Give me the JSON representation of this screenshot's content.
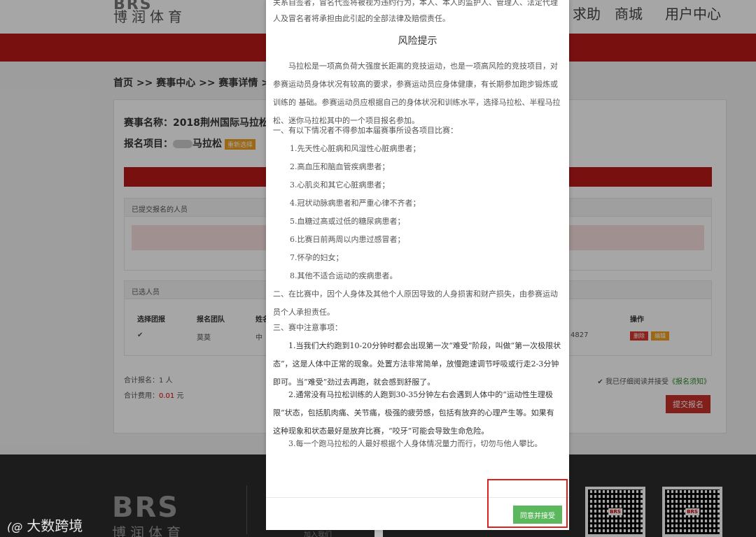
{
  "header": {
    "logo_brs": "BRS",
    "logo_cn": "博润体育",
    "nav": [
      "求助",
      "商城",
      "用户中心"
    ]
  },
  "breadcrumb": "首页 >> 赛事中心 >> 赛事详情 >> 赛",
  "event": {
    "name_label": "赛事名称：2018荆州国际马拉松",
    "project_label": "报名项目：",
    "project_name": "马拉松",
    "reselect": "重新选择"
  },
  "submitted_panel": {
    "title": "已提交报名的人员"
  },
  "selected_panel": {
    "title": "已选人员",
    "columns": [
      "选择团报",
      "报名团队",
      "姓名",
      "操作"
    ],
    "row": {
      "checkbox": "✔",
      "team": "莫莫",
      "name": "中",
      "phone_tail": "4827",
      "delete": "删除",
      "edit": "编辑"
    }
  },
  "summary": {
    "total_count": "合计报名：1 人",
    "total_fee_label": "合计费用：",
    "total_fee_value": "0.01",
    "total_fee_unit": " 元"
  },
  "agreement": {
    "check": "✔",
    "text": "我已仔细阅读并接受",
    "link": "《报名须知》"
  },
  "submit_button": "提交报名",
  "footer": {
    "logo_brs": "BRS",
    "logo_cn": "博润体育",
    "link": "加入我们"
  },
  "watermark": {
    "mark": "(@",
    "text": "大数跨境"
  },
  "modal": {
    "top_text": "关系自签者，冒名代签将被视为违约行为，本人、本人的监护人、管理人、法定代理人及冒名者将承担由此引起的全部法律及赔偿责任。",
    "title": "风险提示",
    "intro": "马拉松是一项高负荷大强度长距离的竞技运动，也是一项高风险的竞技项目，对参赛运动员身体状况有较高的要求，参赛运动员应身体健康，有长期参加跑步锻炼或训练的 基础。参赛运动员应根据自己的身体状况和训练水平，选择马拉松、半程马拉松、迷你马拉松其中的一个项目报名参加。",
    "section1": "一、有以下情况者不得参加本届赛事所设各项目比赛：",
    "conditions": [
      "1.先天性心脏病和风湿性心脏病患者；",
      "2.高血压和脑血管疾病患者；",
      "3.心肌炎和其它心脏病患者；",
      "4.冠状动脉病患者和严重心律不齐者；",
      "5.血糖过高或过低的糖尿病患者；",
      "6.比赛日前两周以内患过感冒者；",
      "7.怀孕的妇女；",
      "8.其他不适合运动的疾病患者。"
    ],
    "section2": "二、在比赛中，因个人身体及其他个人原因导致的人身损害和财产损失，由参赛运动员个人承担责任。",
    "section3": "三、赛中注意事项：",
    "note1": "1.当我们大约跑到10-20分钟时都会出现第一次“难受”阶段，叫做“第一次极限状态”，这是人体中正常的现象。处置方法非常简单，放慢跑速调节呼吸或行走2-3分钟即可。当“难受”劲过去再跑，就会感到舒服了。",
    "note2": "2.通常没有马拉松训练的人跑到30-35分钟左右会遇到人体中的“运动性生理极限”状态，包括肌肉痛、关节痛，极强的疲劳感，包括有放弃的心理产生等。如果有这种现象和状态最好是放弃比赛，“咬牙”可能会导致生命危险。",
    "note3": "3.每一个跑马拉松的人最好根据个人身体情况量力而行，切勿与他人攀比。",
    "agree_button": "同意并接受"
  }
}
